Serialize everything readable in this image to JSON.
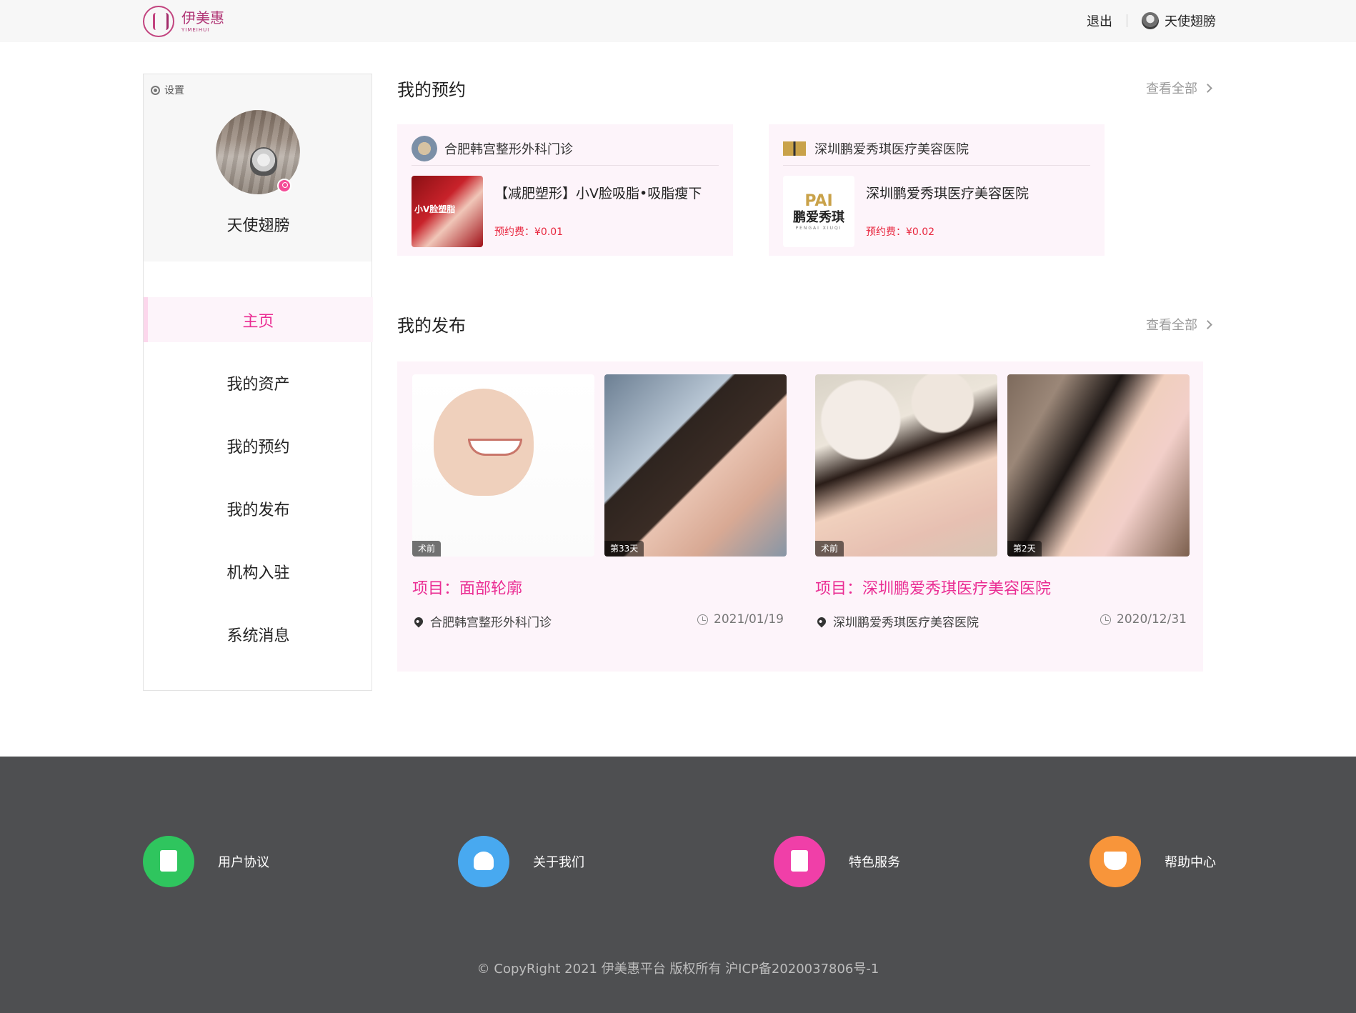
{
  "brand": {
    "name": "伊美惠",
    "subtitle": "YIMEIHUI",
    "accent_color": "#ea2d93"
  },
  "header": {
    "logout_label": "退出",
    "user_name": "天使翅膀",
    "icons": {
      "avatar": "avatar"
    }
  },
  "sidebar": {
    "settings_label": "设置",
    "user_name": "天使翅膀",
    "menu": [
      {
        "label": "主页",
        "active": true
      },
      {
        "label": "我的资产",
        "active": false
      },
      {
        "label": "我的预约",
        "active": false
      },
      {
        "label": "我的发布",
        "active": false
      },
      {
        "label": "机构入驻",
        "active": false
      },
      {
        "label": "系统消息",
        "active": false
      }
    ]
  },
  "reservations": {
    "title": "我的预约",
    "view_all": "查看全部",
    "items": [
      {
        "clinic": "合肥韩宫整形外科门诊",
        "item_title": "【减肥塑形】小V脸吸脂•吸脂瘦下",
        "price": "预约费：¥0.01",
        "thumb_text": "小V脸塑脂"
      },
      {
        "clinic": "深圳鹏爱秀琪医疗美容医院",
        "item_title": "深圳鹏爱秀琪医疗美容医院",
        "price": "预约费：¥0.02",
        "thumb_brand": "PAI",
        "thumb_cn": "鹏爱秀琪",
        "thumb_en": "PENGAI XIUQI"
      }
    ]
  },
  "publications": {
    "title": "我的发布",
    "view_all": "查看全部",
    "items": [
      {
        "tags": [
          "术前",
          "第33天"
        ],
        "title": "项目：面部轮廓",
        "location": "合肥韩宫整形外科门诊",
        "date": "2021/01/19"
      },
      {
        "tags": [
          "术前",
          "第2天"
        ],
        "title": "项目：深圳鹏爱秀琪医疗美容医院",
        "location": "深圳鹏爱秀琪医疗美容医院",
        "date": "2020/12/31"
      }
    ]
  },
  "footer": {
    "links": [
      {
        "label": "用户协议",
        "icon": "document-icon",
        "color": "#2fc55e"
      },
      {
        "label": "关于我们",
        "icon": "users-icon",
        "color": "#48a9f0"
      },
      {
        "label": "特色服务",
        "icon": "list-icon",
        "color": "#f03fa8"
      },
      {
        "label": "帮助中心",
        "icon": "book-icon",
        "color": "#f8953a"
      }
    ],
    "copyright": "© CopyRight 2021  伊美惠平台  版权所有    沪ICP备2020037806号-1"
  }
}
